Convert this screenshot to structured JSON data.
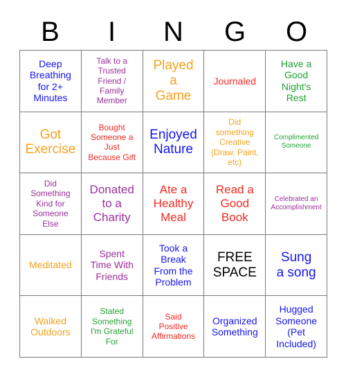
{
  "header": {
    "letters": [
      "B",
      "I",
      "N",
      "G",
      "O"
    ],
    "letter_color": "#000000"
  },
  "grid": {
    "columns": 5,
    "rows": 5,
    "border_color": "#7a7a7a",
    "background": "#ffffff"
  },
  "palette": {
    "blue": "#1414ee",
    "purple": "#9b2f9b",
    "orange": "#f5a21e",
    "red": "#ef2a23",
    "green": "#22a033",
    "black": "#000000"
  },
  "cells": [
    {
      "text": "Deep\nBreathing\nfor 2+\nMinutes",
      "color": "#1414ee",
      "size": "fs-md"
    },
    {
      "text": "Talk to a\nTrusted\nFriend /\nFamily\nMember",
      "color": "#9b2f9b",
      "size": "fs-sm"
    },
    {
      "text": "Played\na\nGame",
      "color": "#f5a21e",
      "size": "fs-xl"
    },
    {
      "text": "Journaled",
      "color": "#ef2a23",
      "size": "fs-md"
    },
    {
      "text": "Have a\nGood\nNight's\nRest",
      "color": "#22a033",
      "size": "fs-md"
    },
    {
      "text": "Got\nExercise",
      "color": "#f5a21e",
      "size": "fs-xl"
    },
    {
      "text": "Bought\nSomeone a\nJust\nBecause Gift",
      "color": "#ef2a23",
      "size": "fs-sm"
    },
    {
      "text": "Enjoyed\nNature",
      "color": "#1414ee",
      "size": "fs-xl"
    },
    {
      "text": "Did\nsomething\nCreative\n(Draw, Paint,\netc)",
      "color": "#f5a21e",
      "size": "fs-sm"
    },
    {
      "text": "Complimented\nSomeone",
      "color": "#22a033",
      "size": "fs-xs"
    },
    {
      "text": "Did\nSomething\nKind for\nSomeone\nElse",
      "color": "#9b2f9b",
      "size": "fs-sm"
    },
    {
      "text": "Donated\nto a\nCharity",
      "color": "#9b2f9b",
      "size": "fs-lg"
    },
    {
      "text": "Ate a\nHealthy\nMeal",
      "color": "#ef2a23",
      "size": "fs-lg"
    },
    {
      "text": "Read a\nGood\nBook",
      "color": "#ef2a23",
      "size": "fs-lg"
    },
    {
      "text": "Celebrated an\nAccomplishment",
      "color": "#9b2f9b",
      "size": "fs-xs"
    },
    {
      "text": "Meditated",
      "color": "#f5a21e",
      "size": "fs-md"
    },
    {
      "text": "Spent\nTime With\nFriends",
      "color": "#9b2f9b",
      "size": "fs-md"
    },
    {
      "text": "Took a\nBreak\nFrom the\nProblem",
      "color": "#1414ee",
      "size": "fs-md"
    },
    {
      "text": "FREE\nSPACE",
      "color": "#000000",
      "size": "fs-xl"
    },
    {
      "text": "Sung\na song",
      "color": "#1414ee",
      "size": "fs-xl"
    },
    {
      "text": "Walked\nOutdoors",
      "color": "#f5a21e",
      "size": "fs-md"
    },
    {
      "text": "Stated\nSomething\nI'm Grateful\nFor",
      "color": "#22a033",
      "size": "fs-sm"
    },
    {
      "text": "Said\nPositive\nAffirmations",
      "color": "#ef2a23",
      "size": "fs-sm"
    },
    {
      "text": "Organized\nSomething",
      "color": "#1414ee",
      "size": "fs-md"
    },
    {
      "text": "Hugged\nSomeone\n(Pet\nIncluded)",
      "color": "#1414ee",
      "size": "fs-md"
    }
  ]
}
